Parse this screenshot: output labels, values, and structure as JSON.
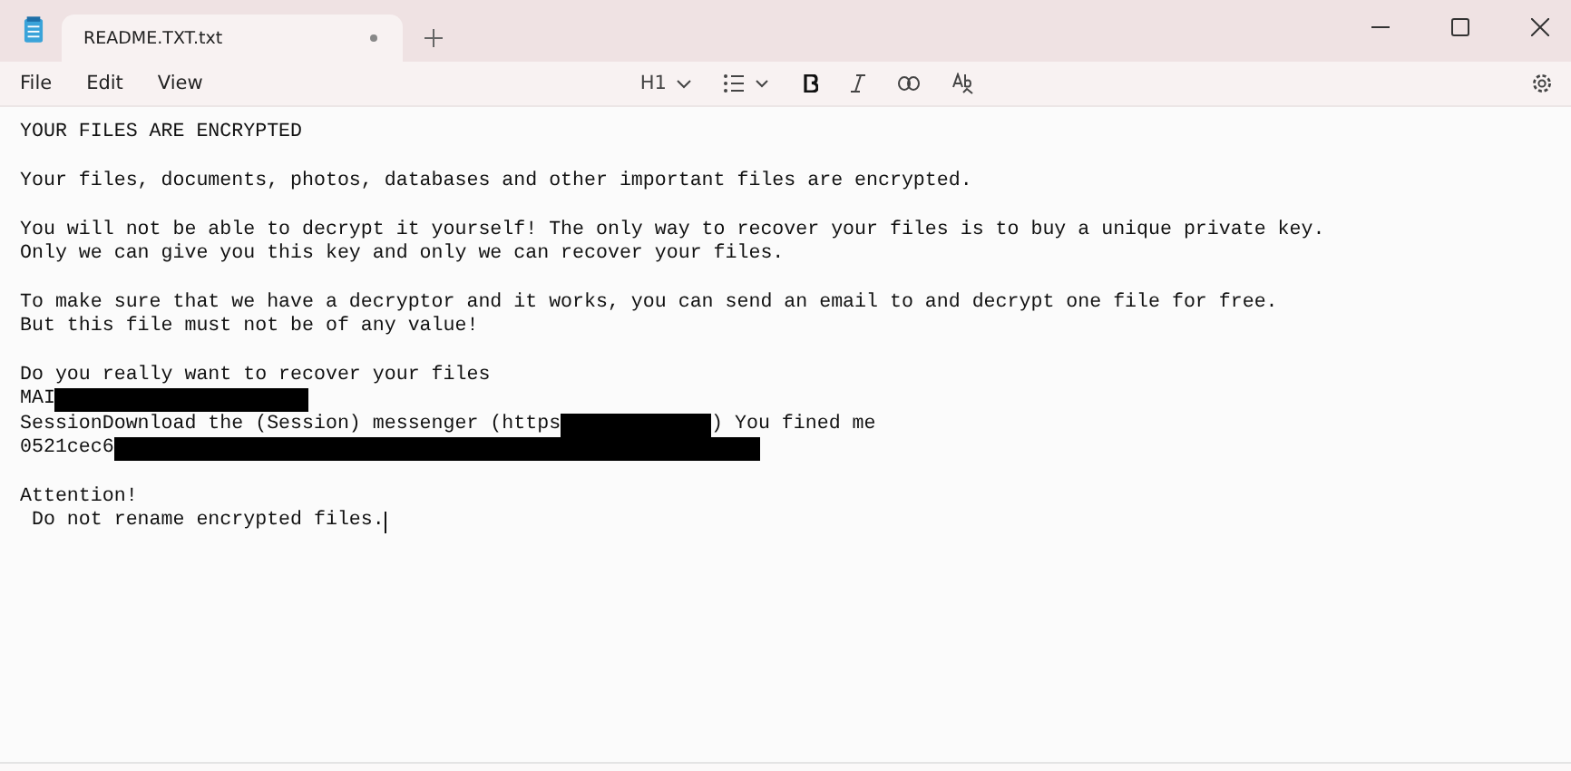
{
  "window": {
    "tabs": [
      {
        "title": "README.TXT.txt",
        "selected": true,
        "modified": true
      }
    ]
  },
  "menu": [
    {
      "label": "File"
    },
    {
      "label": "Edit"
    },
    {
      "label": "View"
    }
  ],
  "toolbar": {
    "heading": "H1"
  },
  "document": {
    "paragraphs": [
      {
        "lines": [
          [
            {
              "kind": "text",
              "text": "YOUR FILES ARE ENCRYPTED"
            }
          ]
        ]
      },
      {
        "lines": [
          [
            {
              "kind": "text",
              "text": "Your files, documents, photos, databases and other important files are encrypted."
            }
          ]
        ]
      },
      {
        "lines": [
          [
            {
              "kind": "text",
              "text": "You will not be able to decrypt it yourself! The only way to recover your files is to buy a unique private key."
            }
          ],
          [
            {
              "kind": "text",
              "text": "Only we can give you this key and only we can recover your files."
            }
          ]
        ]
      },
      {
        "lines": [
          [
            {
              "kind": "text",
              "text": "To make sure that we have a decryptor and it works, you can send an email to and decrypt one file for free."
            }
          ],
          [
            {
              "kind": "text",
              "text": "But this file must not be of any value!"
            }
          ]
        ]
      },
      {
        "lines": [
          [
            {
              "kind": "text",
              "text": "Do you really want to recover your files"
            }
          ],
          [
            {
              "kind": "text",
              "text": "MAI"
            },
            {
              "kind": "redacted"
            }
          ],
          [
            {
              "kind": "text",
              "text": "SessionDownload the (Session) messenger (https"
            },
            {
              "kind": "redacted"
            },
            {
              "kind": "text",
              "text": ") You fined me"
            }
          ],
          [
            {
              "kind": "text",
              "text": "0521cec6"
            },
            {
              "kind": "redacted"
            }
          ]
        ]
      },
      {
        "lines": [
          [
            {
              "kind": "text",
              "text": "Attention!"
            }
          ],
          [
            {
              "kind": "text",
              "text": " Do not rename encrypted files."
            },
            {
              "kind": "cursor"
            }
          ]
        ]
      }
    ]
  }
}
